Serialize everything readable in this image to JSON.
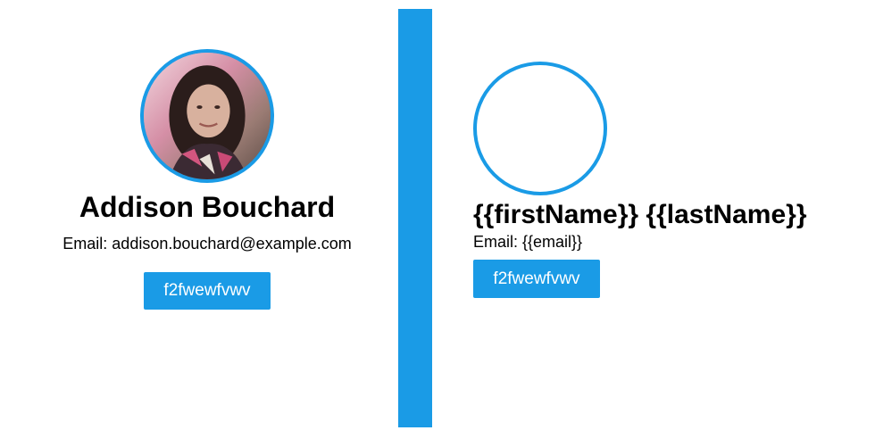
{
  "left_card": {
    "name": "Addison Bouchard",
    "email_line": "Email: addison.bouchard@example.com",
    "button_label": "f2fwewfvwv",
    "avatar": "profile-photo"
  },
  "right_card": {
    "name": "{{firstName}} {{lastName}}",
    "email_line": "Email: {{email}}",
    "button_label": "f2fwewfvwv",
    "avatar": "empty-avatar-placeholder"
  },
  "colors": {
    "accent": "#1a9be6",
    "text": "#000000",
    "background": "#ffffff"
  }
}
